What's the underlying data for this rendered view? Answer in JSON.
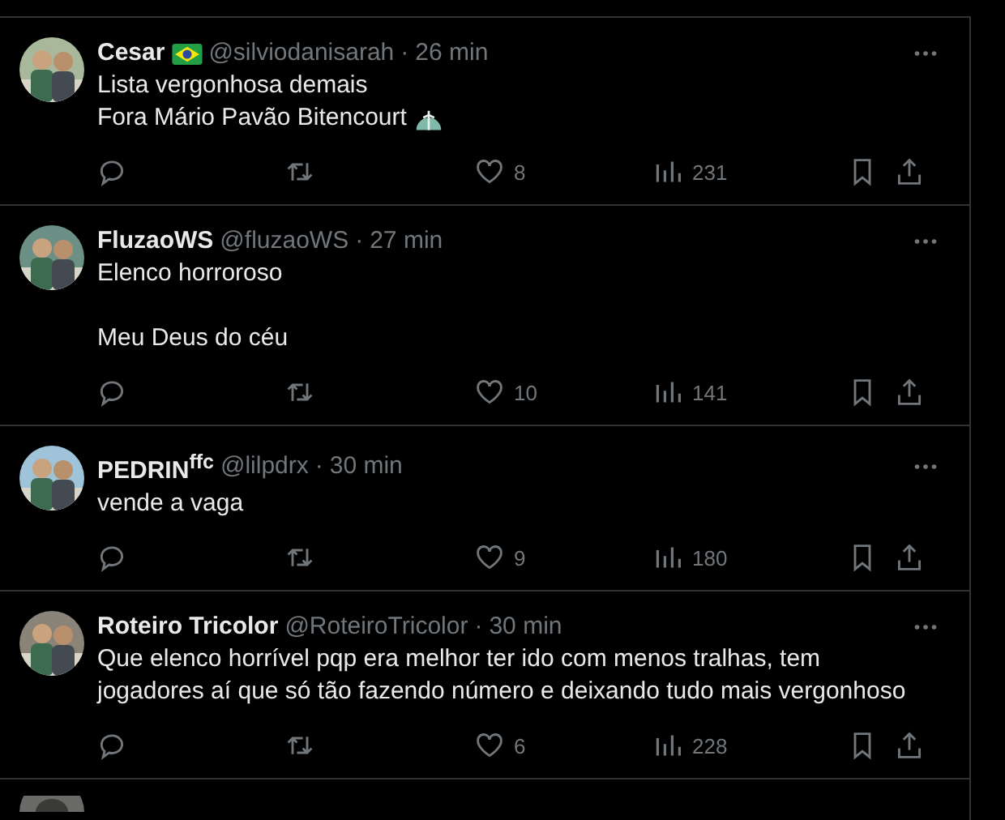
{
  "posts": [
    {
      "name": "Cesar",
      "name_badge": {
        "kind": "flag"
      },
      "handle": "@silviodanisarah",
      "separator": "·",
      "time": "26 min",
      "avatar": {
        "kind": "picture"
      },
      "paragraphs": [
        [
          "Lista vergonhosa demais",
          "Fora Mário Pavão Bitencourt"
        ]
      ],
      "text_emoji": {
        "kind": "statue"
      },
      "likes": "8",
      "views": "231"
    },
    {
      "name": "FluzaoWS",
      "handle": "@fluzaoWS",
      "separator": "·",
      "time": "27 min",
      "avatar": {
        "kind": "picture"
      },
      "paragraphs": [
        [
          "Elenco horroroso"
        ],
        [
          "Meu Deus do céu"
        ]
      ],
      "likes": "10",
      "views": "141"
    },
    {
      "name": "PEDRIN$^{ffc}$",
      "handle": "@lilpdrx",
      "separator": "·",
      "time": "30 min",
      "avatar": {
        "kind": "picture"
      },
      "paragraphs": [
        [
          "vende a vaga"
        ]
      ],
      "likes": "9",
      "views": "180"
    },
    {
      "name": "Roteiro Tricolor",
      "handle": "@RoteiroTricolor",
      "separator": "·",
      "time": "30 min",
      "avatar": {
        "kind": "picture"
      },
      "paragraphs": [
        [
          "Que elenco horrível pqp era melhor ter ido com menos tralhas, tem jogadores aí que só tão fazendo número e deixando tudo mais vergonhoso"
        ]
      ],
      "likes": "6",
      "views": "228"
    }
  ],
  "cut_off_post": {
    "avatar": {
      "kind": "picture"
    }
  }
}
